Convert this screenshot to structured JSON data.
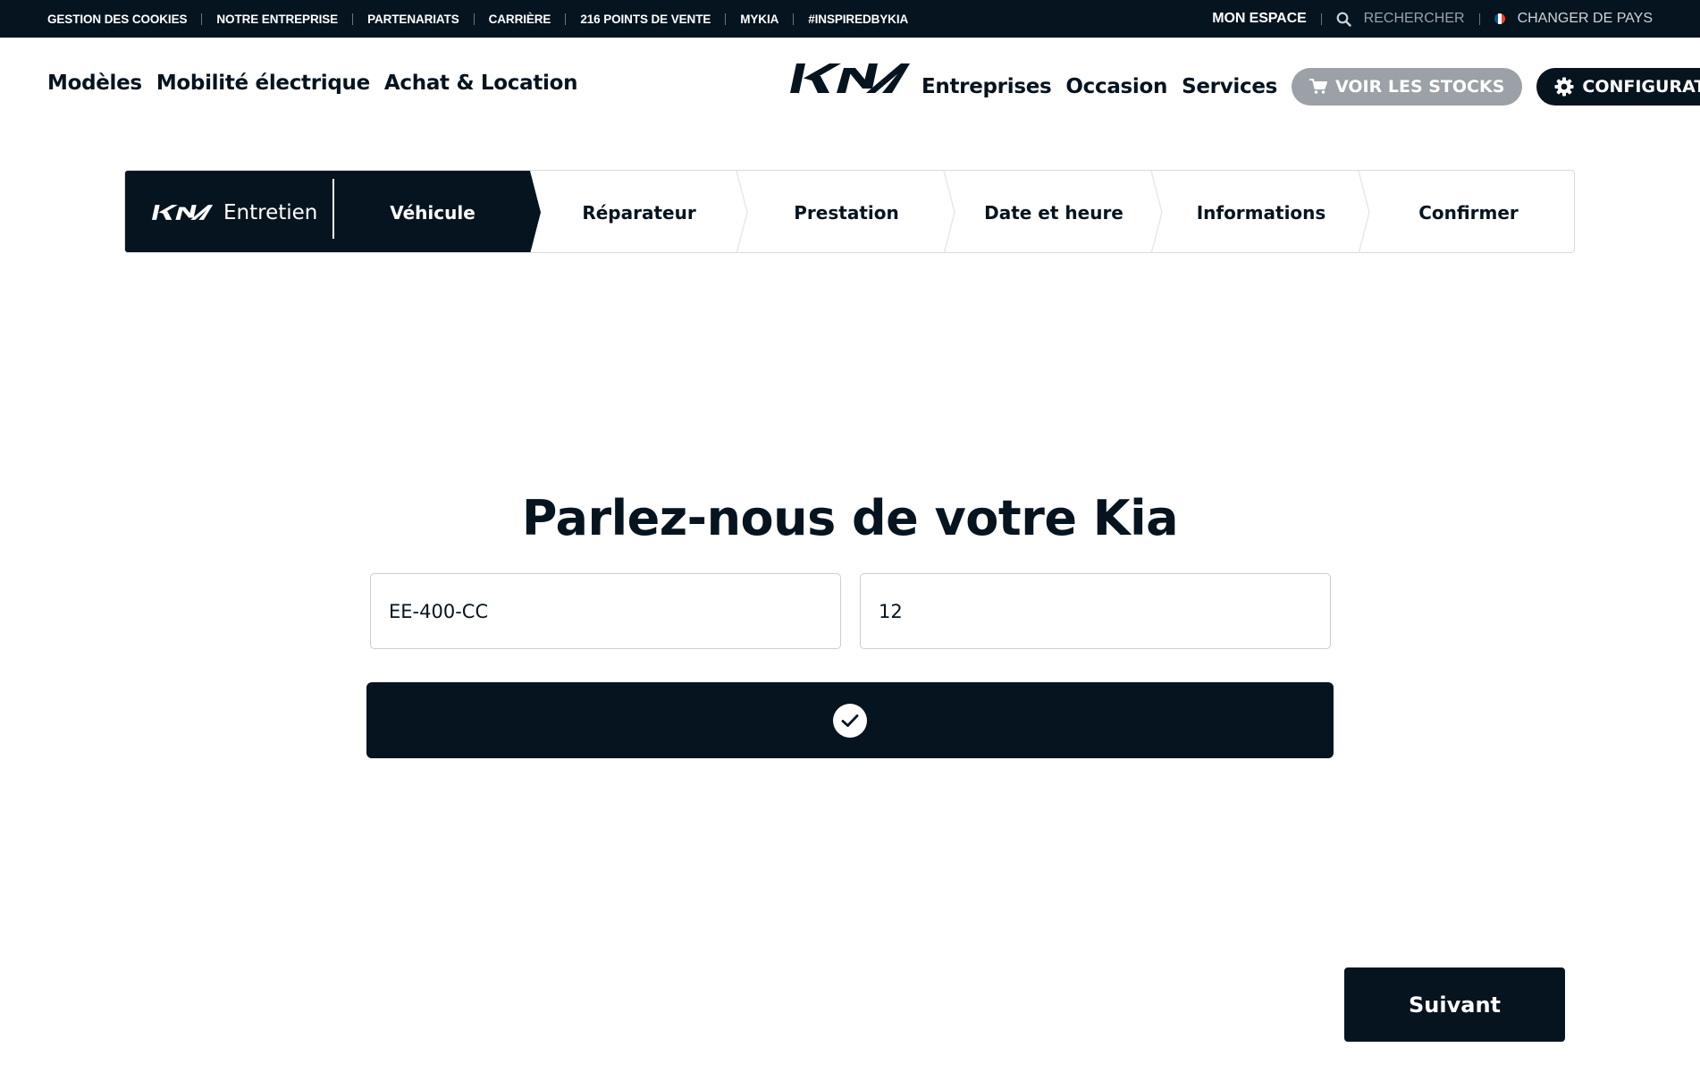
{
  "utility_bar": {
    "links": [
      "GESTION DES COOKIES",
      "NOTRE ENTREPRISE",
      "PARTENARIATS",
      "CARRIÈRE",
      "216 POINTS DE VENTE",
      "MYKIA",
      "#INSPIREDBYKIA"
    ],
    "account": "MON ESPACE",
    "search_label": "RECHERCHER",
    "country_label": "CHANGER DE PAYS",
    "flag_colors": [
      "#0055a4",
      "#ffffff",
      "#ef4135"
    ]
  },
  "main_nav": {
    "left_links": [
      "Modèles",
      "Mobilité électrique",
      "Achat & Location"
    ],
    "right_links": [
      "Entreprises",
      "Occasion",
      "Services"
    ],
    "stock_button": "VOIR LES STOCKS",
    "configurator_button": "CONFIGURATEUR",
    "stock_icon": "cart-icon",
    "configurator_icon": "gear-icon"
  },
  "stepper": {
    "brand_label": "Entretien",
    "active_index": 0,
    "steps": [
      "Véhicule",
      "Réparateur",
      "Prestation",
      "Date et heure",
      "Informations",
      "Confirmer"
    ]
  },
  "vehicle_form": {
    "title": "Parlez-nous de votre Kia",
    "plate_value": "EE-400-CC",
    "mileage_value": "12",
    "confirm_icon": "check-icon"
  },
  "footer_actions": {
    "next_label": "Suivant"
  },
  "colors": {
    "primary": "#05141f",
    "disabled_button": "#9ba1a6",
    "border": "#d9dcdf"
  }
}
